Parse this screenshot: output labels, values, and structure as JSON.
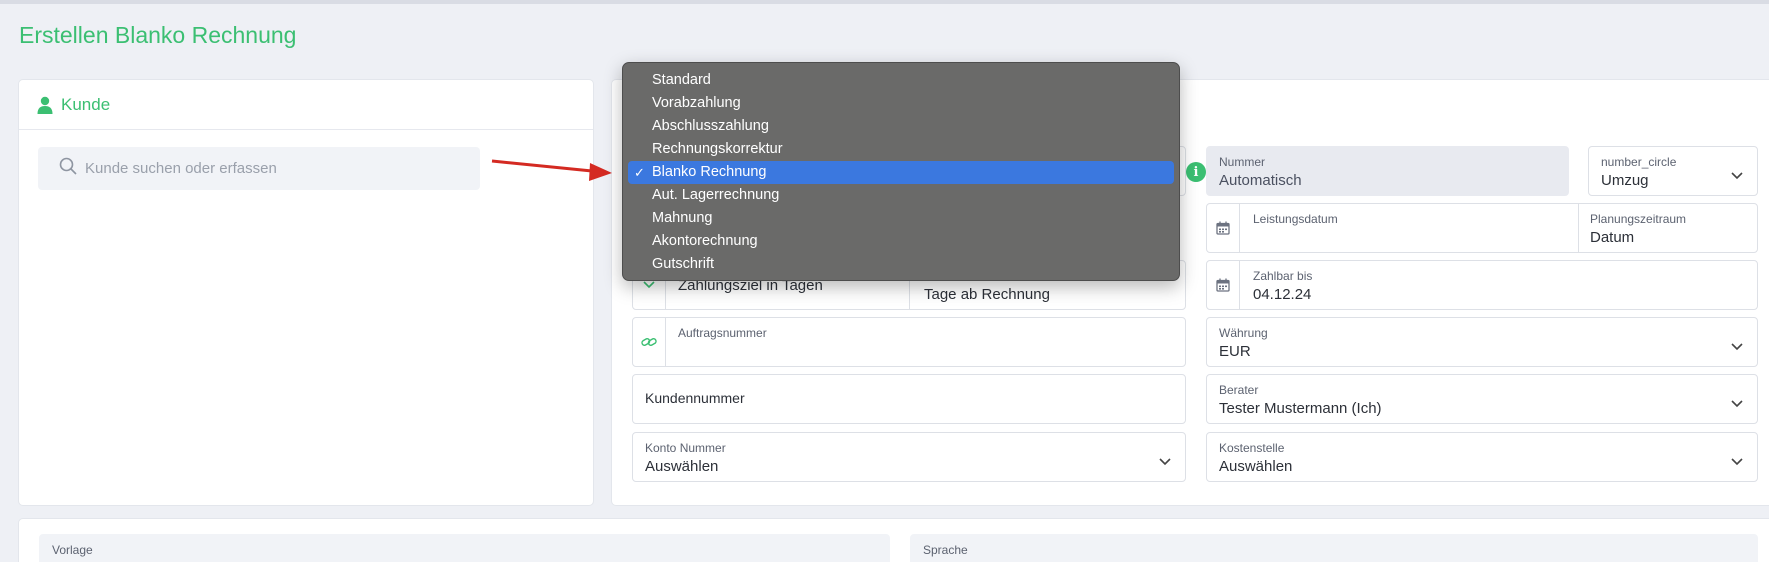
{
  "page": {
    "title": "Erstellen Blanko Rechnung"
  },
  "kunde_card": {
    "title": "Kunde",
    "search_placeholder": "Kunde suchen oder erfassen"
  },
  "invoice_type_menu": {
    "items": [
      "Standard",
      "Vorabzahlung",
      "Abschlusszahlung",
      "Rechnungskorrektur",
      "Blanko Rechnung",
      "Aut. Lagerrechnung",
      "Mahnung",
      "Akontorechnung",
      "Gutschrift"
    ],
    "selected": "Blanko Rechnung",
    "check_mark": "✓"
  },
  "fields": {
    "nummer": {
      "label": "Nummer",
      "value": "Automatisch",
      "info": "i"
    },
    "number_circle": {
      "label": "number_circle",
      "value": "Umzug"
    },
    "leistungsdatum": {
      "label": "Leistungsdatum",
      "value": ""
    },
    "planungszeitraum": {
      "label": "Planungszeitraum",
      "value": "Datum"
    },
    "zahlungsziel": {
      "value": "Zahlungsziel in Tagen",
      "unit": "Tage ab Rechnung"
    },
    "zahlbar_bis": {
      "label": "Zahlbar bis",
      "value": "04.12.24"
    },
    "auftragsnummer": {
      "label": "Auftragsnummer",
      "value": ""
    },
    "waehrung": {
      "label": "Währung",
      "value": "EUR"
    },
    "kundennummer": {
      "value": "Kundennummer"
    },
    "berater": {
      "label": "Berater",
      "value": "Tester Mustermann (Ich)"
    },
    "konto_nummer": {
      "label": "Konto Nummer",
      "value": "Auswählen"
    },
    "kostenstelle": {
      "label": "Kostenstelle",
      "value": "Auswählen"
    },
    "vorlage": {
      "label": "Vorlage"
    },
    "sprache": {
      "label": "Sprache"
    }
  },
  "colors": {
    "accent": "#3bbf72",
    "menu_bg": "#6a6a69",
    "menu_selected": "#3b78df",
    "arrow": "#d42a22"
  }
}
